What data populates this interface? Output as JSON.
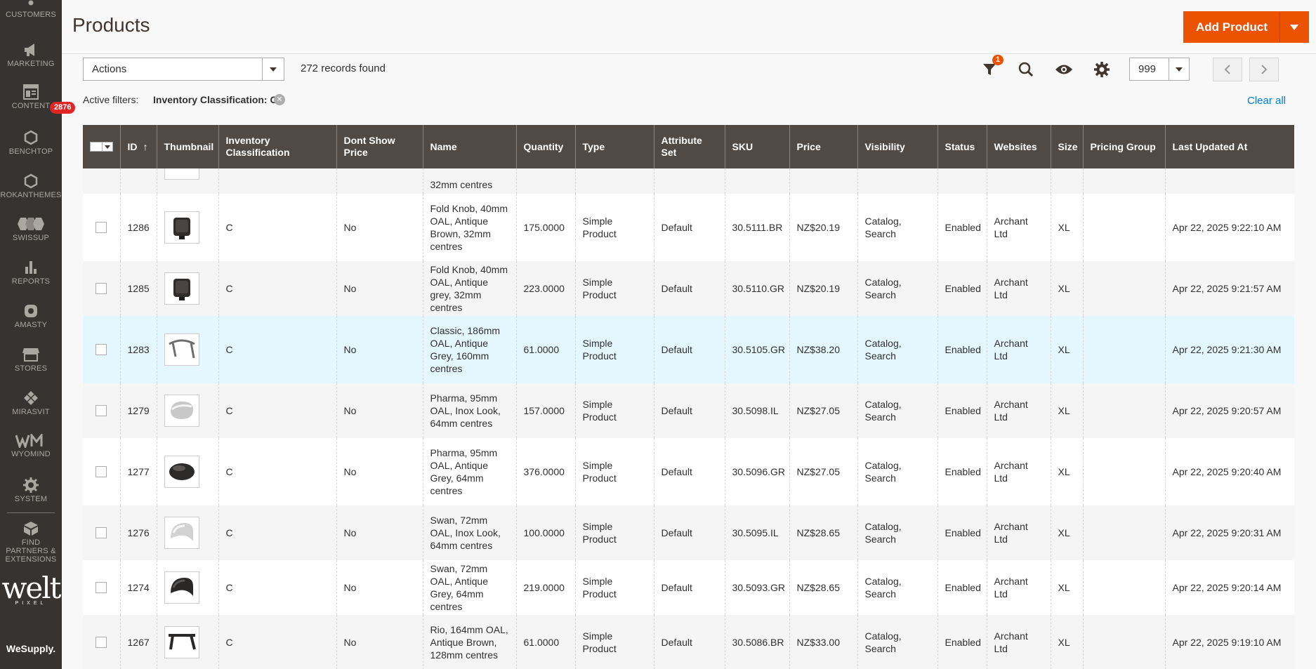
{
  "sidebar": {
    "items": [
      {
        "label": "CUSTOMERS",
        "icon": "customers-icon"
      },
      {
        "label": "MARKETING",
        "icon": "megaphone-icon"
      },
      {
        "label": "CONTENT",
        "icon": "content-icon"
      },
      {
        "label": "BENCHTOP",
        "icon": "hexagon-icon"
      },
      {
        "label": "ROKANTHEMES",
        "icon": "hexagon-icon"
      },
      {
        "label": "SWISSUP",
        "icon": "swissup-icon"
      },
      {
        "label": "REPORTS",
        "icon": "bar-chart-icon"
      },
      {
        "label": "AMASTY",
        "icon": "amasty-icon"
      },
      {
        "label": "STORES",
        "icon": "store-icon"
      },
      {
        "label": "MIRASVIT",
        "icon": "diamond-icon"
      },
      {
        "label": "WYOMIND",
        "icon": "wyomind-icon"
      },
      {
        "label": "SYSTEM",
        "icon": "gear-icon"
      },
      {
        "label": "FIND PARTNERS & EXTENSIONS",
        "icon": "partners-box-icon"
      }
    ],
    "notification_count": "2876",
    "logo_text": "welt",
    "logo_sub": "PIXEL",
    "footer_brand": "WeSupply."
  },
  "header": {
    "title": "Products",
    "add_button": "Add Product"
  },
  "toolbar": {
    "actions_label": "Actions",
    "records_found": "272 records found",
    "filter_count": "1",
    "per_page": "999"
  },
  "filters": {
    "active_label": "Active filters:",
    "chip": "Inventory Classification: C",
    "clear_all": "Clear all"
  },
  "grid": {
    "columns": [
      "ID",
      "Thumbnail",
      "Inventory Classification",
      "Dont Show Price",
      "Name",
      "Quantity",
      "Type",
      "Attribute Set",
      "SKU",
      "Price",
      "Visibility",
      "Status",
      "Websites",
      "Size",
      "Pricing Group",
      "Last Updated At"
    ],
    "partial_row_text": "32mm centres",
    "rows": [
      {
        "id": "1286",
        "inv": "C",
        "dsp": "No",
        "name": "Fold Knob, 40mm OAL, Antique Brown, 32mm centres",
        "qty": "175.0000",
        "type": "Simple Product",
        "attr": "Default",
        "sku": "30.5111.BR",
        "price": "NZ$20.19",
        "vis": "Catalog, Search",
        "status": "Enabled",
        "web": "Archant Ltd",
        "size": "XL",
        "pg": "",
        "updated": "Apr 22, 2025 9:22:10 AM",
        "thumb": "fold-knob-icon"
      },
      {
        "id": "1285",
        "inv": "C",
        "dsp": "No",
        "name": "Fold Knob, 40mm OAL, Antique grey, 32mm centres",
        "qty": "223.0000",
        "type": "Simple Product",
        "attr": "Default",
        "sku": "30.5110.GR",
        "price": "NZ$20.19",
        "vis": "Catalog, Search",
        "status": "Enabled",
        "web": "Archant Ltd",
        "size": "XL",
        "pg": "",
        "updated": "Apr 22, 2025 9:21:57 AM",
        "thumb": "fold-knob-icon"
      },
      {
        "id": "1283",
        "inv": "C",
        "dsp": "No",
        "name": "Classic, 186mm OAL, Antique Grey, 160mm centres",
        "qty": "61.0000",
        "type": "Simple Product",
        "attr": "Default",
        "sku": "30.5105.GR",
        "price": "NZ$38.20",
        "vis": "Catalog, Search",
        "status": "Enabled",
        "web": "Archant Ltd",
        "size": "XL",
        "pg": "",
        "updated": "Apr 22, 2025 9:21:30 AM",
        "thumb": "handle-icon"
      },
      {
        "id": "1279",
        "inv": "C",
        "dsp": "No",
        "name": "Pharma, 95mm OAL, Inox Look, 64mm centres",
        "qty": "157.0000",
        "type": "Simple Product",
        "attr": "Default",
        "sku": "30.5098.IL",
        "price": "NZ$27.05",
        "vis": "Catalog, Search",
        "status": "Enabled",
        "web": "Archant Ltd",
        "size": "XL",
        "pg": "",
        "updated": "Apr 22, 2025 9:20:57 AM",
        "thumb": "pull-silver-icon"
      },
      {
        "id": "1277",
        "inv": "C",
        "dsp": "No",
        "name": "Pharma, 95mm OAL, Antique Grey, 64mm centres",
        "qty": "376.0000",
        "type": "Simple Product",
        "attr": "Default",
        "sku": "30.5096.GR",
        "price": "NZ$27.05",
        "vis": "Catalog, Search",
        "status": "Enabled",
        "web": "Archant Ltd",
        "size": "XL",
        "pg": "",
        "updated": "Apr 22, 2025 9:20:40 AM",
        "thumb": "pull-dark-icon"
      },
      {
        "id": "1276",
        "inv": "C",
        "dsp": "No",
        "name": "Swan, 72mm OAL, Inox Look, 64mm centres",
        "qty": "100.0000",
        "type": "Simple Product",
        "attr": "Default",
        "sku": "30.5095.IL",
        "price": "NZ$28.65",
        "vis": "Catalog, Search",
        "status": "Enabled",
        "web": "Archant Ltd",
        "size": "XL",
        "pg": "",
        "updated": "Apr 22, 2025 9:20:31 AM",
        "thumb": "swan-silver-icon"
      },
      {
        "id": "1274",
        "inv": "C",
        "dsp": "No",
        "name": "Swan, 72mm OAL, Antique Grey, 64mm centres",
        "qty": "219.0000",
        "type": "Simple Product",
        "attr": "Default",
        "sku": "30.5093.GR",
        "price": "NZ$28.65",
        "vis": "Catalog, Search",
        "status": "Enabled",
        "web": "Archant Ltd",
        "size": "XL",
        "pg": "",
        "updated": "Apr 22, 2025 9:20:14 AM",
        "thumb": "swan-dark-icon"
      },
      {
        "id": "1267",
        "inv": "C",
        "dsp": "No",
        "name": "Rio, 164mm OAL, Antique Brown, 128mm centres",
        "qty": "61.0000",
        "type": "Simple Product",
        "attr": "Default",
        "sku": "30.5086.BR",
        "price": "NZ$33.00",
        "vis": "Catalog, Search",
        "status": "Enabled",
        "web": "Archant Ltd",
        "size": "XL",
        "pg": "",
        "updated": "Apr 22, 2025 9:19:10 AM",
        "thumb": "rio-handle-icon"
      }
    ]
  }
}
